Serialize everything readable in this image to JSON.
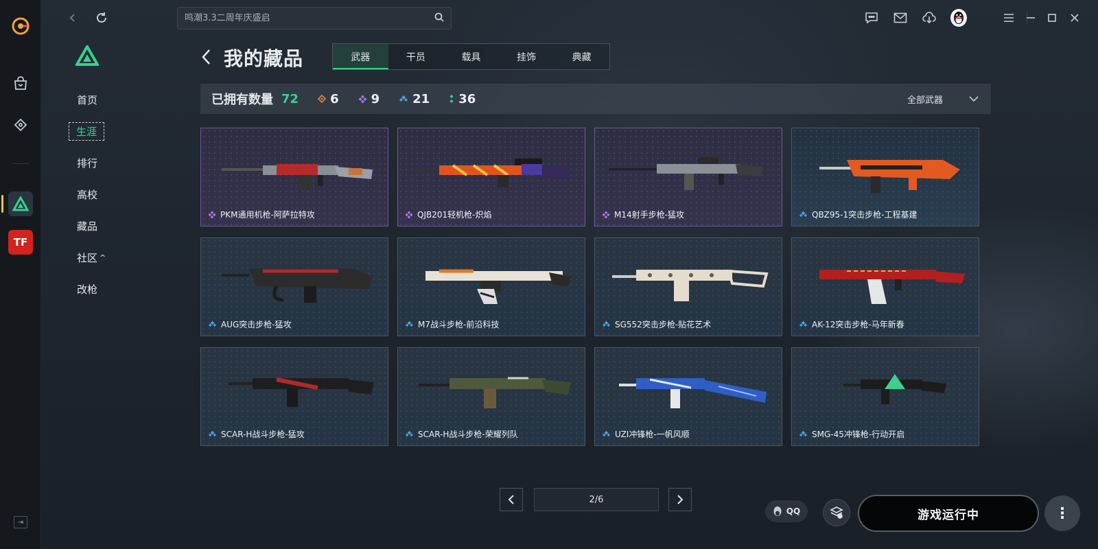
{
  "topbar": {
    "search_placeholder": "鸣潮3.3二周年庆盛启"
  },
  "rail": {
    "tiles": [
      {
        "name": "delta-force",
        "active": true
      },
      {
        "name": "cf-game",
        "text": "TF"
      }
    ]
  },
  "sidenav": {
    "items": [
      {
        "label": "首页"
      },
      {
        "label": "生涯",
        "active": true
      },
      {
        "label": "排行"
      },
      {
        "label": "高校"
      },
      {
        "label": "藏品"
      },
      {
        "label": "社区"
      },
      {
        "label": "改枪"
      }
    ]
  },
  "header": {
    "title": "我的藏品",
    "tabs": [
      {
        "label": "武器",
        "active": true
      },
      {
        "label": "干员"
      },
      {
        "label": "载具"
      },
      {
        "label": "挂饰"
      },
      {
        "label": "典藏"
      }
    ]
  },
  "summary": {
    "owned_label": "已拥有数量",
    "owned_count": "72",
    "rarities": [
      {
        "tier": "gold",
        "color": "#e08a3a",
        "count": "6"
      },
      {
        "tier": "purple",
        "color": "#a77be6",
        "count": "9"
      },
      {
        "tier": "blue",
        "color": "#4aa3e6",
        "count": "21"
      },
      {
        "tier": "green",
        "color": "#3ecf8e",
        "count": "36"
      }
    ],
    "filter_label": "全部武器"
  },
  "items": [
    {
      "name": "PKM通用机枪-阿萨拉特攻",
      "rarity": "purple"
    },
    {
      "name": "QJB201轻机枪-炽焰",
      "rarity": "purple"
    },
    {
      "name": "M14射手步枪-猛攻",
      "rarity": "purple"
    },
    {
      "name": "QBZ95-1突击步枪-工程基建",
      "rarity": "blue"
    },
    {
      "name": "AUG突击步枪-猛攻",
      "rarity": "blue"
    },
    {
      "name": "M7战斗步枪-前沿科技",
      "rarity": "blue"
    },
    {
      "name": "SG552突击步枪-贴花艺术",
      "rarity": "blue"
    },
    {
      "name": "AK-12突击步枪-马年新春",
      "rarity": "blue"
    },
    {
      "name": "SCAR-H战斗步枪-猛攻",
      "rarity": "blue"
    },
    {
      "name": "SCAR-H战斗步枪-荣耀列队",
      "rarity": "blue"
    },
    {
      "name": "UZI冲锋枪-一帆风顺",
      "rarity": "blue"
    },
    {
      "name": "SMG-45冲锋枪-行动开启",
      "rarity": "blue"
    }
  ],
  "pagination": {
    "text": "2/6"
  },
  "footer": {
    "qq_label": "QQ",
    "launch_label": "游戏运行中"
  }
}
